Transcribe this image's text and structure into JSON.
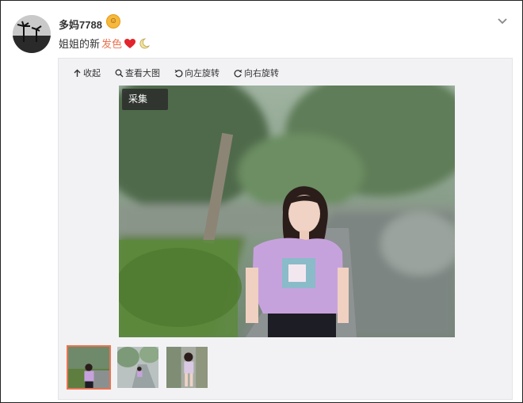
{
  "post": {
    "username": "多妈7788",
    "text_before": "姐姐的新",
    "text_highlight": "发色",
    "badge_icon": "vip-crown-icon",
    "emoji_heart": "red-heart-icon",
    "emoji_moon": "crescent-moon-icon"
  },
  "toolbar": {
    "collapse_label": "收起",
    "view_large_label": "查看大图",
    "rotate_left_label": "向左旋转",
    "rotate_right_label": "向右旋转"
  },
  "photo": {
    "caiji_label": "采集"
  },
  "thumbnails": [
    {
      "selected": true
    },
    {
      "selected": false
    },
    {
      "selected": false
    }
  ],
  "colors": {
    "accent": "#eb7350",
    "panel_bg": "#f2f2f5"
  }
}
